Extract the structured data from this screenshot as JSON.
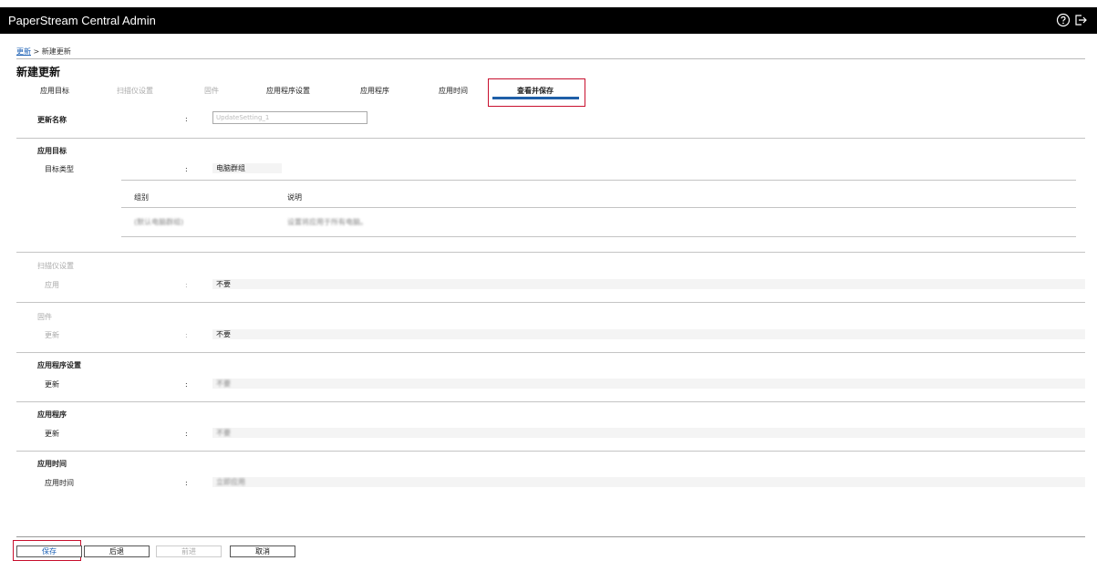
{
  "app": {
    "title": "PaperStream Central Admin"
  },
  "topbar": {
    "help_icon": "help-circle-icon",
    "logout_icon": "logout-icon"
  },
  "breadcrumb": {
    "link": "更新",
    "separator": " > ",
    "current": "新建更新"
  },
  "page": {
    "title": "新建更新"
  },
  "tabs": [
    {
      "label": "应用目标",
      "state": "normal"
    },
    {
      "label": "扫描仪设置",
      "state": "disabled"
    },
    {
      "label": "固件",
      "state": "disabled"
    },
    {
      "label": "应用程序设置",
      "state": "normal"
    },
    {
      "label": "应用程序",
      "state": "normal"
    },
    {
      "label": "应用时间",
      "state": "normal"
    },
    {
      "label": "查看并保存",
      "state": "active"
    }
  ],
  "update_name": {
    "label": "更新名称",
    "colon": ":",
    "value": "UpdateSetting_1"
  },
  "target": {
    "heading": "应用目标",
    "type_label": "目标类型",
    "colon": ":",
    "type_value": "电脑群组",
    "table": {
      "headers": [
        "组别",
        "说明"
      ],
      "rows": [
        [
          "(默认电脑群组)",
          "设置将应用于所有电脑。"
        ]
      ]
    }
  },
  "scanner": {
    "heading": "扫描仪设置",
    "label": "应用",
    "colon": ":",
    "value": "不要"
  },
  "firmware": {
    "heading": "固件",
    "label": "更新",
    "colon": ":",
    "value": "不要"
  },
  "app_settings": {
    "heading": "应用程序设置",
    "label": "更新",
    "colon": ":",
    "value": "不要"
  },
  "application": {
    "heading": "应用程序",
    "label": "更新",
    "colon": ":",
    "value": "不要"
  },
  "apply_time": {
    "heading": "应用时间",
    "label": "应用时间",
    "colon": ":",
    "value": "立即应用"
  },
  "buttons": {
    "save": "保存",
    "back": "后退",
    "next": "前进",
    "cancel": "取消"
  },
  "colors": {
    "accent": "#1f5fa8",
    "highlight": "#c8102e",
    "topbar": "#000000"
  }
}
